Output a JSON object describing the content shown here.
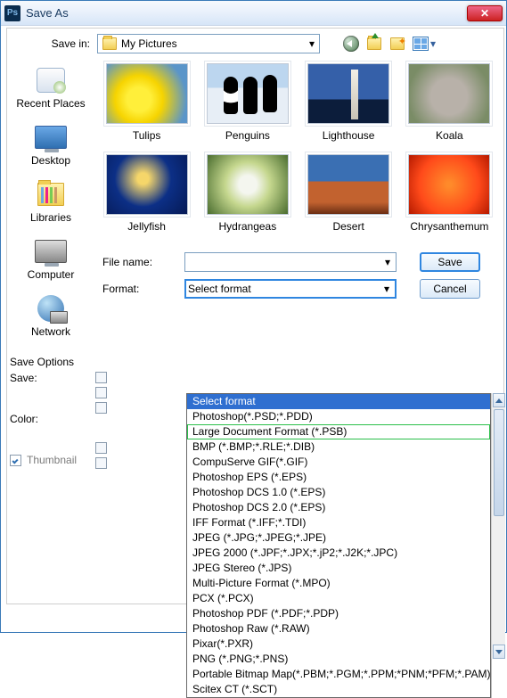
{
  "window": {
    "title": "Save As"
  },
  "savein": {
    "label": "Save in:",
    "value": "My Pictures"
  },
  "places": [
    {
      "key": "recent",
      "label": "Recent Places"
    },
    {
      "key": "desktop",
      "label": "Desktop"
    },
    {
      "key": "libraries",
      "label": "Libraries"
    },
    {
      "key": "computer",
      "label": "Computer"
    },
    {
      "key": "network",
      "label": "Network"
    }
  ],
  "thumbs": [
    {
      "key": "tulips",
      "label": "Tulips"
    },
    {
      "key": "penguins",
      "label": "Penguins"
    },
    {
      "key": "lighthouse",
      "label": "Lighthouse"
    },
    {
      "key": "koala",
      "label": "Koala"
    },
    {
      "key": "jellyfish",
      "label": "Jellyfish"
    },
    {
      "key": "hydrangeas",
      "label": "Hydrangeas"
    },
    {
      "key": "desert",
      "label": "Desert"
    },
    {
      "key": "chrysanthemum",
      "label": "Chrysanthemum"
    }
  ],
  "fields": {
    "filename_label": "File name:",
    "filename_value": "",
    "format_label": "Format:",
    "format_value": "Select format"
  },
  "buttons": {
    "save": "Save",
    "cancel": "Cancel"
  },
  "options": {
    "title": "Save Options",
    "save_label": "Save:",
    "color_label": "Color:",
    "thumbnail_label": "Thumbnail",
    "thumbnail_checked": true
  },
  "format_options": [
    {
      "label": "Select format",
      "selected": true
    },
    {
      "label": "Photoshop(*.PSD;*.PDD)"
    },
    {
      "label": "Large Document Format (*.PSB)",
      "highlighted": true
    },
    {
      "label": "BMP (*.BMP;*.RLE;*.DIB)"
    },
    {
      "label": "CompuServe GIF(*.GIF)"
    },
    {
      "label": "Photoshop EPS (*.EPS)"
    },
    {
      "label": "Photoshop DCS 1.0 (*.EPS)"
    },
    {
      "label": "Photoshop DCS 2.0 (*.EPS)"
    },
    {
      "label": "IFF Format (*.IFF;*.TDI)"
    },
    {
      "label": "JPEG (*.JPG;*.JPEG;*.JPE)"
    },
    {
      "label": "JPEG 2000 (*.JPF;*.JPX;*.jP2;*.J2K;*.JPC)"
    },
    {
      "label": "JPEG Stereo (*.JPS)"
    },
    {
      "label": "Multi-Picture Format (*.MPO)"
    },
    {
      "label": "PCX (*.PCX)"
    },
    {
      "label": "Photoshop PDF (*.PDF;*.PDP)"
    },
    {
      "label": "Photoshop Raw (*.RAW)"
    },
    {
      "label": "Pixar(*.PXR)"
    },
    {
      "label": "PNG (*.PNG;*.PNS)"
    },
    {
      "label": "Portable Bitmap Map(*.PBM;*.PGM;*.PPM;*PNM;*PFM;*.PAM)"
    },
    {
      "label": "Scitex CT (*.SCT)"
    }
  ]
}
